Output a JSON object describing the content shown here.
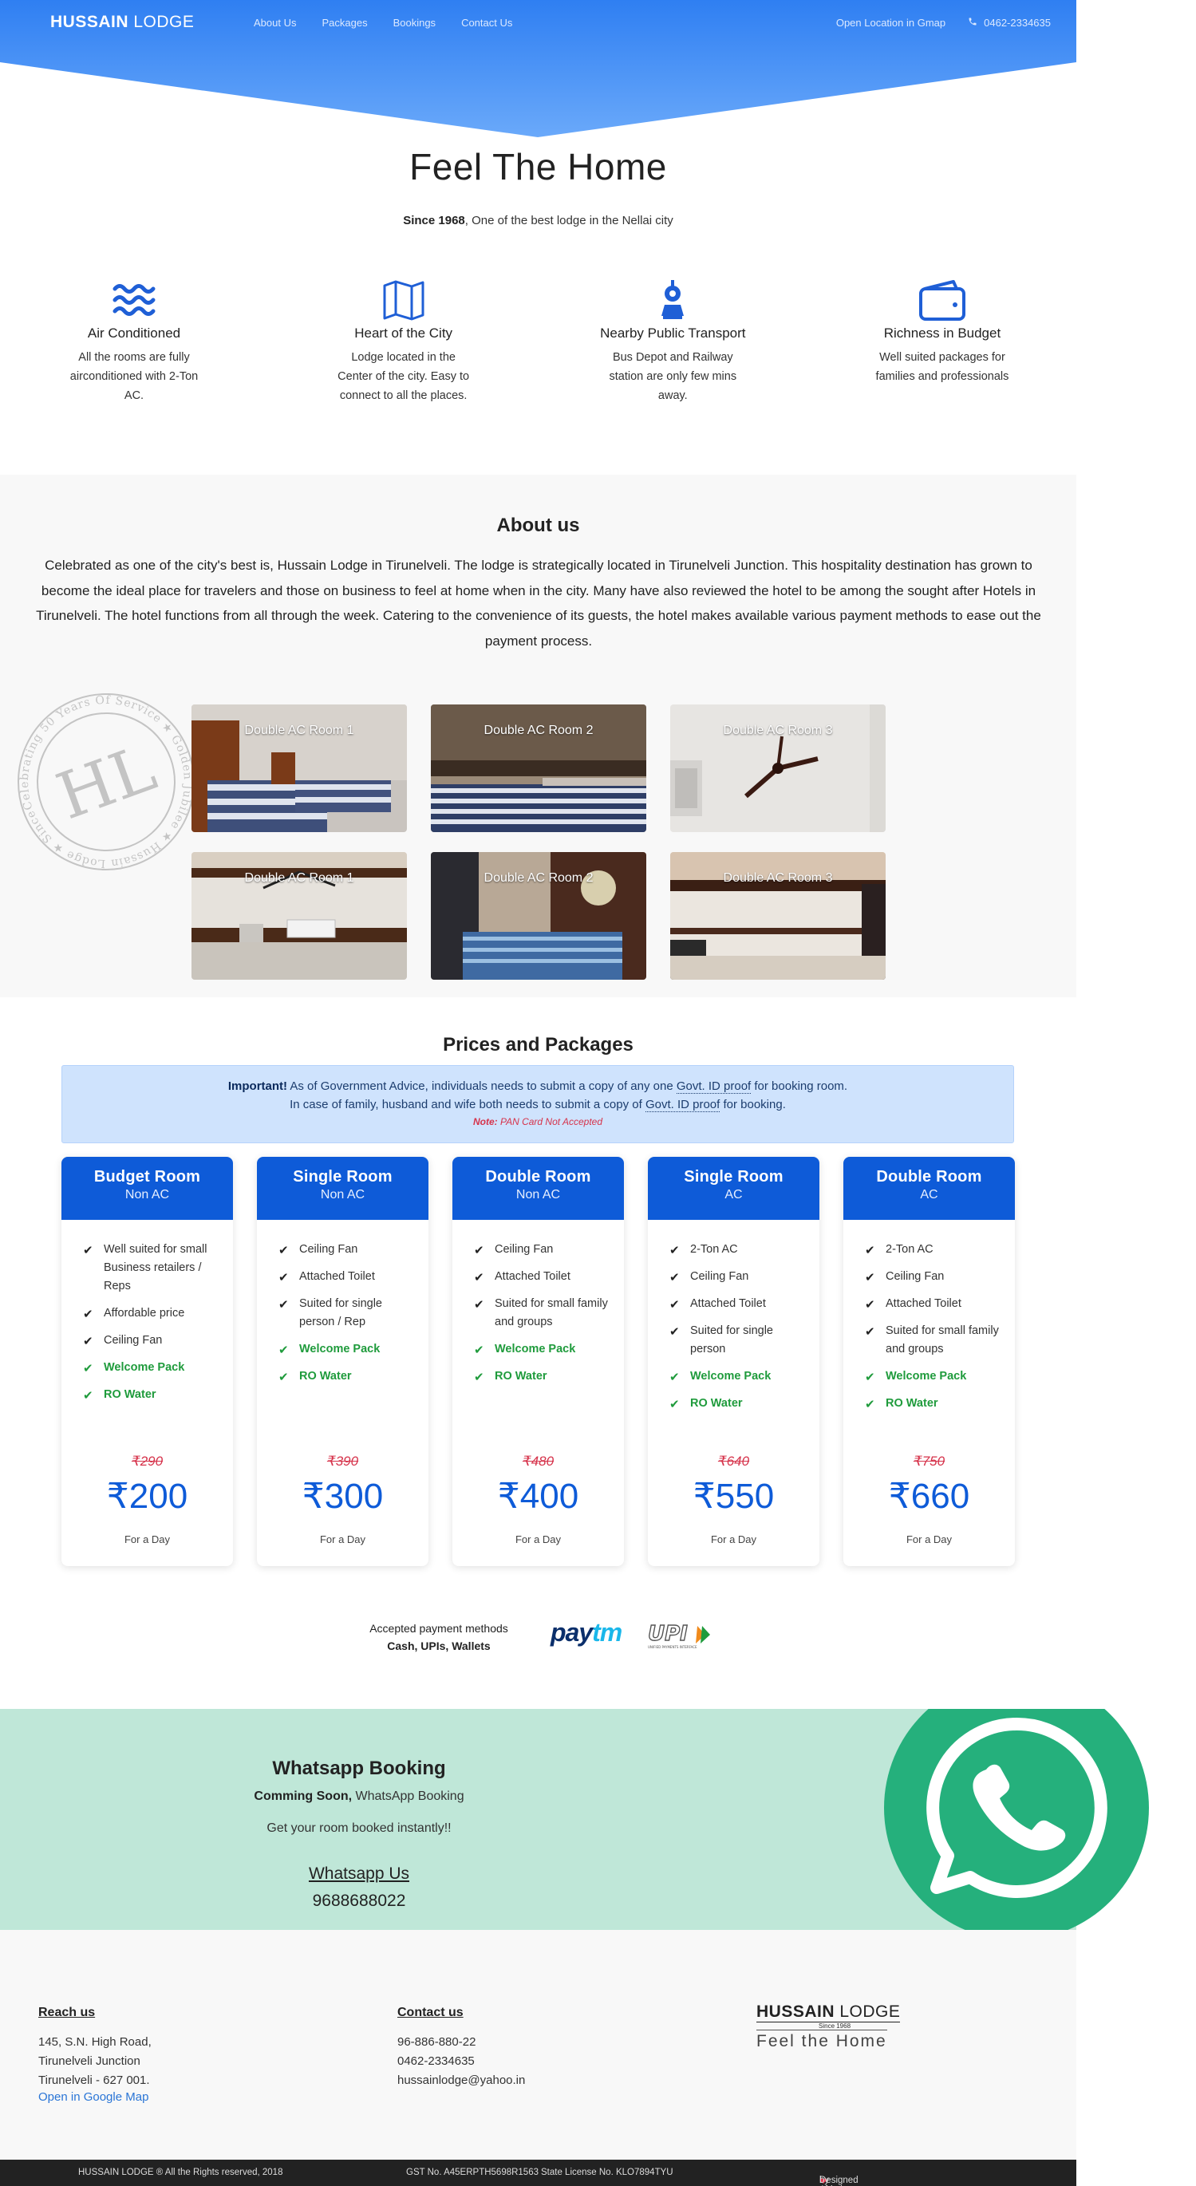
{
  "nav": {
    "brand_bold": "HUSSAIN",
    "brand_rest": " LODGE",
    "links": [
      "About Us",
      "Packages",
      "Bookings",
      "Contact Us"
    ],
    "gmap": "Open Location in Gmap",
    "phone": "0462-2334635"
  },
  "hero": {
    "title": "Feel The Home",
    "since": "Since 1968",
    "subtitle": ", One of the best lodge in the Nellai city"
  },
  "features": [
    {
      "icon": "waves-icon",
      "title": "Air Conditioned",
      "text": "All the rooms are fully airconditioned with 2-Ton AC."
    },
    {
      "icon": "map-icon",
      "title": "Heart of the City",
      "text": "Lodge located in the Center of the city. Easy to connect to all the places."
    },
    {
      "icon": "train-icon",
      "title": "Nearby Public Transport",
      "text": "Bus Depot and Railway station are only few mins away."
    },
    {
      "icon": "wallet-icon",
      "title": "Richness in Budget",
      "text": "Well suited packages for families and professionals"
    }
  ],
  "about": {
    "title": "About us",
    "text": "Celebrated as one of the city's best is, Hussain Lodge in Tirunelveli. The lodge is strategically located in Tirunelveli Junction. This hospitality destination has grown to become the ideal place for travelers and those on business to feel at home when in the city. Many have also reviewed the hotel to be among the sought after Hotels in Tirunelveli. The hotel functions from all through the week. Catering to the convenience of its guests, the hotel makes available various payment methods to ease out the payment process.",
    "stamp_monogram": "HL",
    "stamp_ring": "Celebrating 50 Years Of Service ★ Golden Jubilee ★ Hussain Lodge ★ Since 1968 ★"
  },
  "gallery": [
    {
      "caption": "Double AC Room 1"
    },
    {
      "caption": "Double AC Room 2"
    },
    {
      "caption": "Double AC Room 3"
    },
    {
      "caption": "Double AC Room 1"
    },
    {
      "caption": "Double AC Room 2"
    },
    {
      "caption": "Double AC Room 3"
    }
  ],
  "prices": {
    "title": "Prices and Packages",
    "notice_important": "Important!",
    "notice_line1_a": " As of Government Advice, individuals needs to submit a copy of any one ",
    "notice_govt": "Govt. ID proof",
    "notice_line1_b": " for booking room.",
    "notice_line2_a": "In case of family, husband and wife both needs to submit a copy of ",
    "notice_line2_b": " for booking.",
    "note_label": "Note:",
    "note_text": " PAN Card Not Accepted",
    "check_glyph": "✔",
    "cards": [
      {
        "title": "Budget Room",
        "type": "Non AC",
        "features": [
          "Well suited for small Business retailers / Reps",
          "Affordable price",
          "Ceiling Fan"
        ],
        "extras": [
          "Welcome Pack",
          "RO Water"
        ],
        "old": "₹290",
        "price": "₹200",
        "per": "For a Day"
      },
      {
        "title": "Single Room",
        "type": "Non AC",
        "features": [
          "Ceiling Fan",
          "Attached Toilet",
          "Suited for single person / Rep"
        ],
        "extras": [
          "Welcome Pack",
          "RO Water"
        ],
        "old": "₹390",
        "price": "₹300",
        "per": "For a Day"
      },
      {
        "title": "Double Room",
        "type": "Non AC",
        "features": [
          "Ceiling Fan",
          "Attached Toilet",
          "Suited for small family and groups"
        ],
        "extras": [
          "Welcome Pack",
          "RO Water"
        ],
        "old": "₹480",
        "price": "₹400",
        "per": "For a Day"
      },
      {
        "title": "Single Room",
        "type": "AC",
        "features": [
          "2-Ton AC",
          "Ceiling Fan",
          "Attached Toilet",
          "Suited for single person"
        ],
        "extras": [
          "Welcome Pack",
          "RO Water"
        ],
        "old": "₹640",
        "price": "₹550",
        "per": "For a Day"
      },
      {
        "title": "Double Room",
        "type": "AC",
        "features": [
          "2-Ton AC",
          "Ceiling Fan",
          "Attached Toilet",
          "Suited for small family and groups"
        ],
        "extras": [
          "Welcome Pack",
          "RO Water"
        ],
        "old": "₹750",
        "price": "₹660",
        "per": "For a Day"
      }
    ]
  },
  "payment": {
    "label": "Accepted payment methods",
    "methods": "Cash, UPIs, Wallets",
    "paytm_a": "pay",
    "paytm_b": "tm",
    "upi": "UPI",
    "upi_small": "UNIFIED PAYMENTS INTERFACE"
  },
  "whatsapp": {
    "title": "Whatsapp Booking",
    "soon": "Comming Soon,",
    "soon_rest": " WhatsApp Booking",
    "instant": "Get your room booked instantly!!",
    "link": "Whatsapp Us",
    "number": "9688688022"
  },
  "footer": {
    "reach_title": "Reach us",
    "address": [
      "145, S.N. High Road,",
      "Tirunelveli Junction",
      "Tirunelveli - 627 001."
    ],
    "map_link": "Open in Google Map",
    "contact_title": "Contact us",
    "contacts": [
      "96-886-880-22",
      "0462-2334635",
      "hussainlodge@yahoo.in"
    ],
    "logo_bold": "HUSSAIN",
    "logo_rest": " LODGE",
    "logo_since": "Since 1968",
    "logo_tag": "Feel the Home"
  },
  "bottom": {
    "copyright": "HUSSAIN LODGE ® All the Rights reserved, 2018",
    "gst": "GST No. A45ERPTH5698R1563",
    "license": "State License No. KLO7894TYU",
    "designed": "Designed with",
    "by": "by Ajmal Hussain"
  },
  "colors": {
    "primary": "#0e5bd8",
    "hero_top": "#2f7ff2",
    "hero_bottom": "#6aa9fa",
    "whatsapp": "#25b07c",
    "whatsapp_bg": "#bfe7d8",
    "green_text": "#1f9b3c",
    "strike_red": "#d6334b"
  }
}
